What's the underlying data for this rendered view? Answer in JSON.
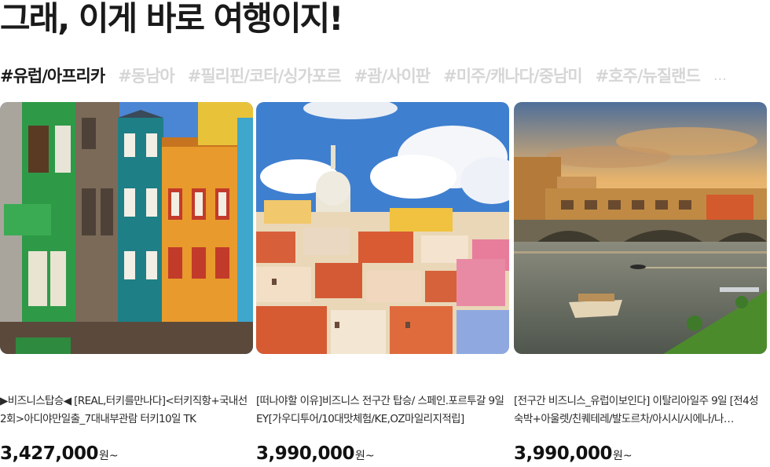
{
  "headline": "그래, 이게 바로 여행이지!",
  "tabs": [
    {
      "label": "#유럽/아프리카",
      "active": true
    },
    {
      "label": "#동남아",
      "active": false
    },
    {
      "label": "#필리핀/코타/싱가포르",
      "active": false
    },
    {
      "label": "#괌/사이판",
      "active": false
    },
    {
      "label": "#미주/캐나다/중남미",
      "active": false
    },
    {
      "label": "#호주/뉴질랜드",
      "active": false
    }
  ],
  "tabs_overflow": "...",
  "products": [
    {
      "title": "▶비즈니스탑승◀ [REAL,터키를만나다]<터키직항+국내선2회>아디야만일출_7대내부관람 터키10일 TK",
      "price": "3,427,000",
      "price_unit": "원~",
      "image": "istanbul-colorful-houses"
    },
    {
      "title": "[떠나야할 이유]비즈니스 전구간 탑승/ 스페인.포르투갈 9일 EY[가우디투어/10대맛체험/KE,OZ마일리지적립]",
      "price": "3,990,000",
      "price_unit": "원~",
      "image": "lisbon-rooftops"
    },
    {
      "title": "[전구간 비즈니스_유럽이보인다] 이탈리아일주 9일 [전4성숙박+아울렛/친퀘테레/발도르차/아시시/시에나/나…",
      "price": "3,990,000",
      "price_unit": "원~",
      "image": "florence-ponte-vecchio"
    }
  ],
  "colors": {
    "tab_active": "#1a1a1a",
    "tab_inactive": "#d6d6d6"
  }
}
